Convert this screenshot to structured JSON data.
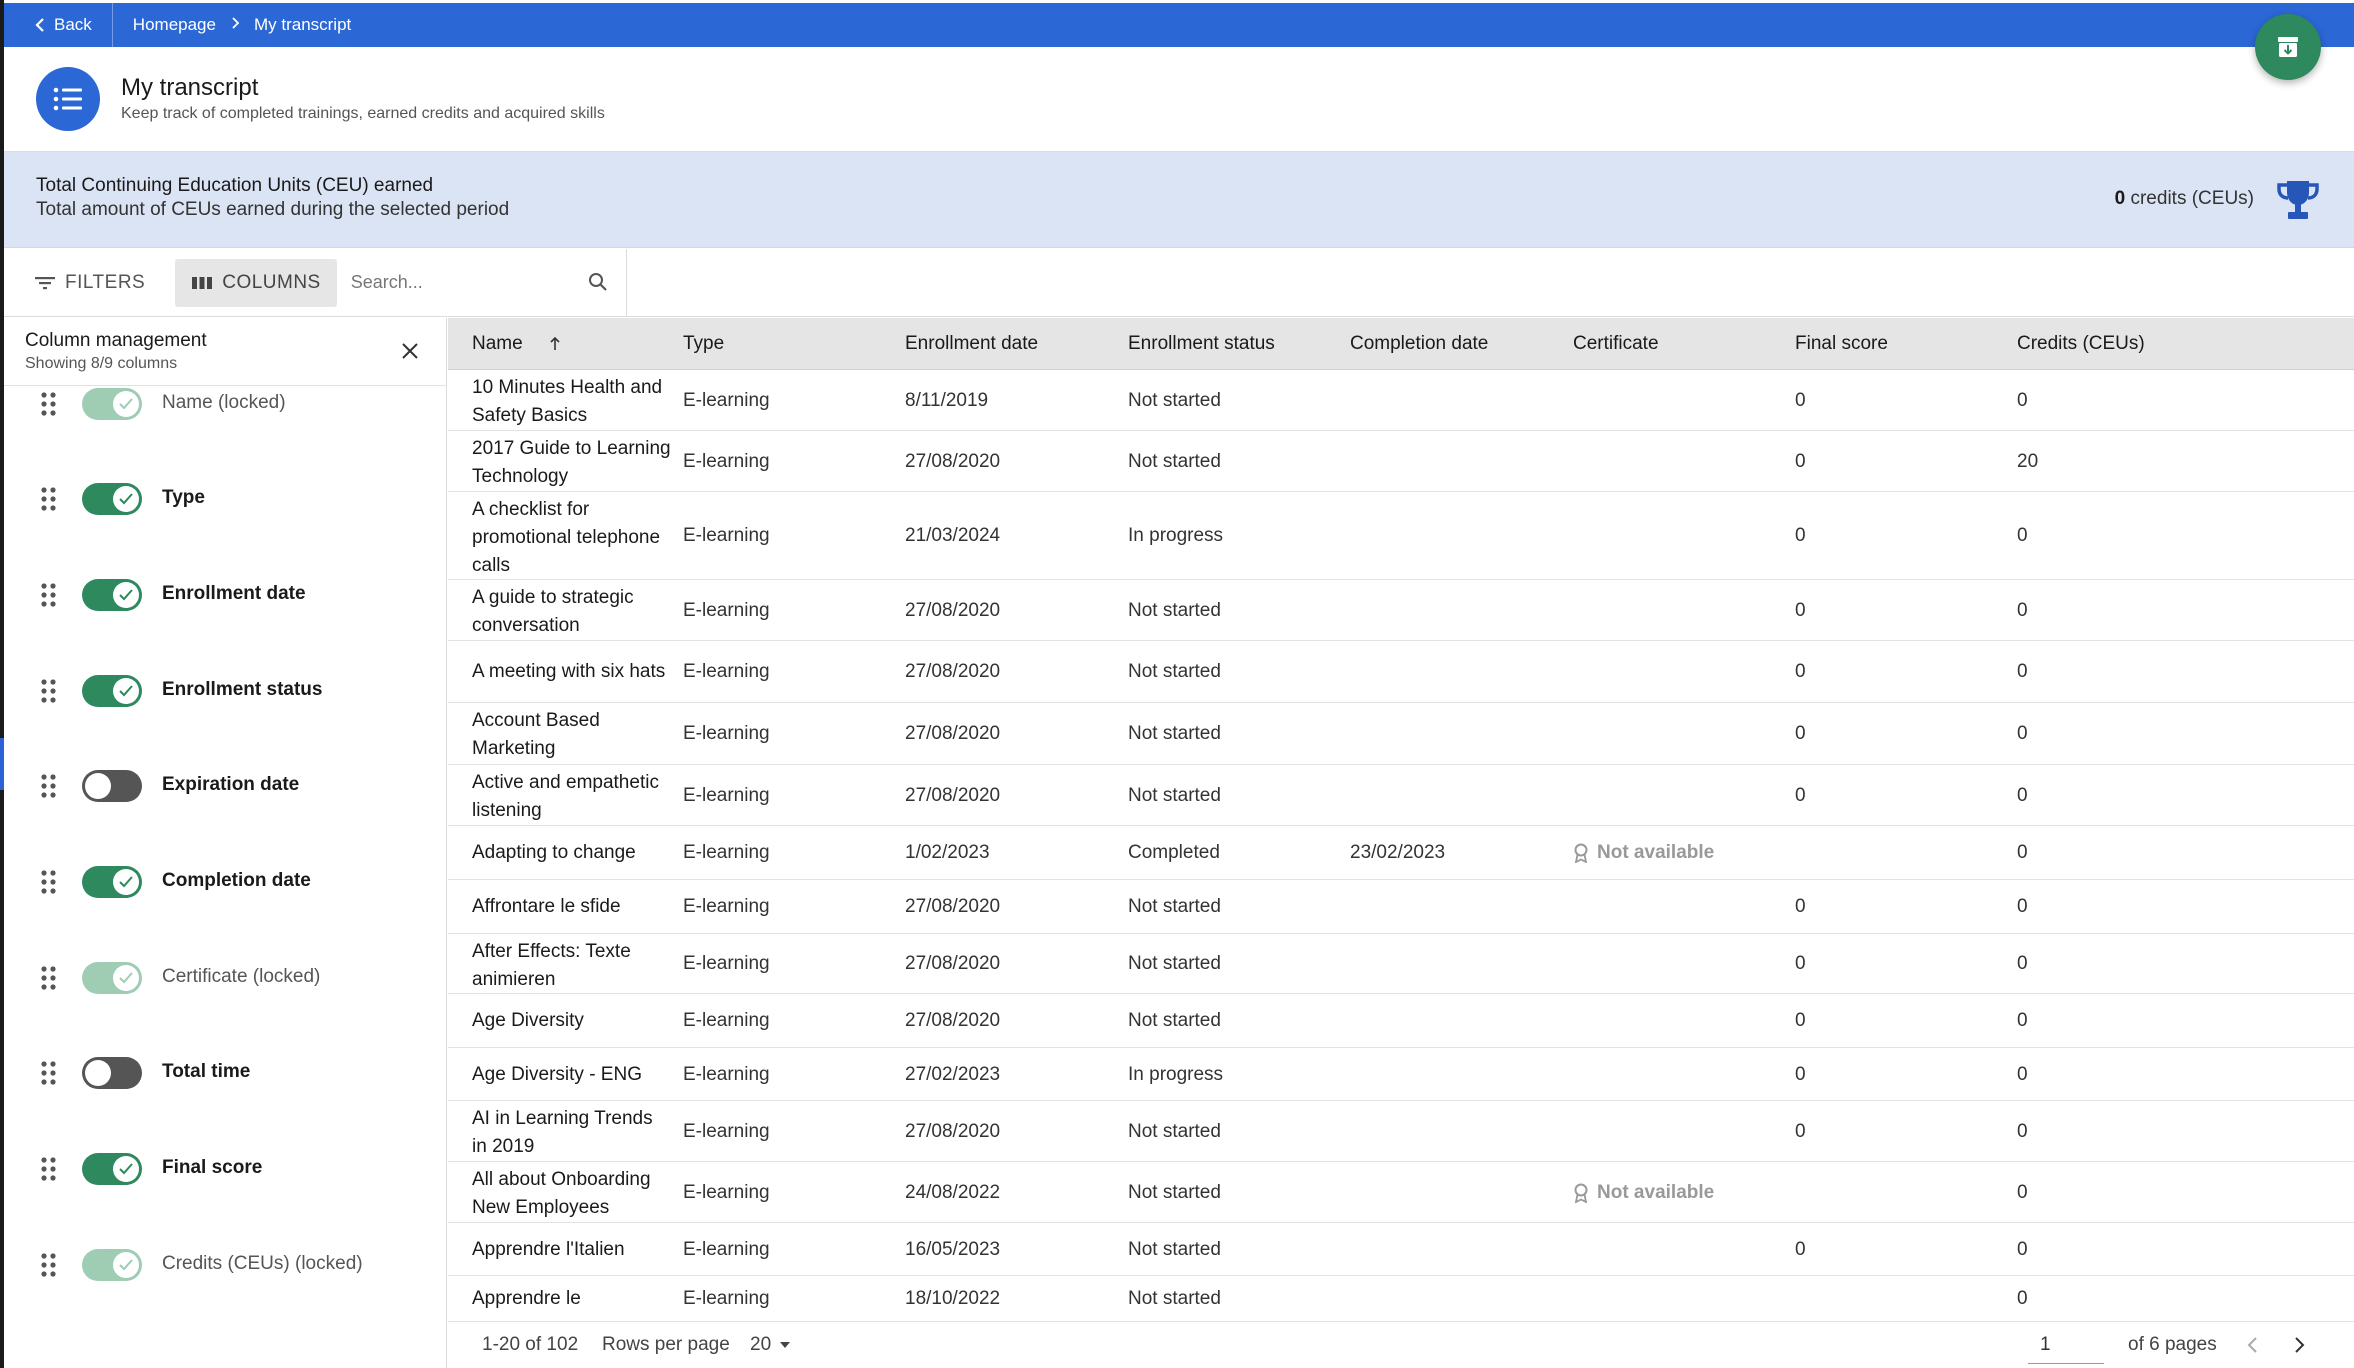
{
  "nav": {
    "back_label": "Back",
    "breadcrumb": [
      "Homepage",
      "My transcript"
    ]
  },
  "header": {
    "title": "My transcript",
    "subtitle": "Keep track of completed trainings, earned credits and acquired skills"
  },
  "ceu": {
    "title": "Total Continuing Education Units (CEU) earned",
    "subtitle": "Total amount of CEUs earned during the selected period",
    "value": "0",
    "unit": "credits (CEUs)"
  },
  "toolbar": {
    "filters_label": "FILTERS",
    "columns_label": "COLUMNS",
    "search_placeholder": "Search..."
  },
  "column_panel": {
    "title": "Column management",
    "subtitle": "Showing 8/9 columns",
    "items": [
      {
        "label": "Name",
        "locked_suffix": "(locked)",
        "state": "locked"
      },
      {
        "label": "Type",
        "locked_suffix": "",
        "state": "on"
      },
      {
        "label": "Enrollment date",
        "locked_suffix": "",
        "state": "on"
      },
      {
        "label": "Enrollment status",
        "locked_suffix": "",
        "state": "on"
      },
      {
        "label": "Expiration date",
        "locked_suffix": "",
        "state": "off"
      },
      {
        "label": "Completion date",
        "locked_suffix": "",
        "state": "on"
      },
      {
        "label": "Certificate",
        "locked_suffix": "(locked)",
        "state": "locked"
      },
      {
        "label": "Total time",
        "locked_suffix": "",
        "state": "off"
      },
      {
        "label": "Final score",
        "locked_suffix": "",
        "state": "on"
      },
      {
        "label": "Credits (CEUs)",
        "locked_suffix": "(locked)",
        "state": "locked"
      }
    ]
  },
  "table": {
    "columns": [
      "Name",
      "Type",
      "Enrollment date",
      "Enrollment status",
      "Completion date",
      "Certificate",
      "Final score",
      "Credits (CEUs)"
    ],
    "rows": [
      {
        "name": "10 Minutes Health and Safety Basics",
        "type": "E-learning",
        "enrollment_date": "8/11/2019",
        "status": "Not started",
        "completion_date": "",
        "certificate": "",
        "final_score": "0",
        "credits": "0"
      },
      {
        "name": "2017 Guide to Learning Technology",
        "type": "E-learning",
        "enrollment_date": "27/08/2020",
        "status": "Not started",
        "completion_date": "",
        "certificate": "",
        "final_score": "0",
        "credits": "20"
      },
      {
        "name": "A checklist for promotional telephone calls",
        "type": "E-learning",
        "enrollment_date": "21/03/2024",
        "status": "In progress",
        "completion_date": "",
        "certificate": "",
        "final_score": "0",
        "credits": "0"
      },
      {
        "name": "A guide to strategic conversation",
        "type": "E-learning",
        "enrollment_date": "27/08/2020",
        "status": "Not started",
        "completion_date": "",
        "certificate": "",
        "final_score": "0",
        "credits": "0"
      },
      {
        "name": "A meeting with six hats",
        "type": "E-learning",
        "enrollment_date": "27/08/2020",
        "status": "Not started",
        "completion_date": "",
        "certificate": "",
        "final_score": "0",
        "credits": "0"
      },
      {
        "name": "Account Based Marketing",
        "type": "E-learning",
        "enrollment_date": "27/08/2020",
        "status": "Not started",
        "completion_date": "",
        "certificate": "",
        "final_score": "0",
        "credits": "0"
      },
      {
        "name": "Active and empathetic listening",
        "type": "E-learning",
        "enrollment_date": "27/08/2020",
        "status": "Not started",
        "completion_date": "",
        "certificate": "",
        "final_score": "0",
        "credits": "0"
      },
      {
        "name": "Adapting to change",
        "type": "E-learning",
        "enrollment_date": "1/02/2023",
        "status": "Completed",
        "completion_date": "23/02/2023",
        "certificate": "Not available",
        "final_score": "",
        "credits": "0"
      },
      {
        "name": "Affrontare le sfide",
        "type": "E-learning",
        "enrollment_date": "27/08/2020",
        "status": "Not started",
        "completion_date": "",
        "certificate": "",
        "final_score": "0",
        "credits": "0"
      },
      {
        "name": "After Effects: Texte animieren",
        "type": "E-learning",
        "enrollment_date": "27/08/2020",
        "status": "Not started",
        "completion_date": "",
        "certificate": "",
        "final_score": "0",
        "credits": "0"
      },
      {
        "name": "Age Diversity",
        "type": "E-learning",
        "enrollment_date": "27/08/2020",
        "status": "Not started",
        "completion_date": "",
        "certificate": "",
        "final_score": "0",
        "credits": "0"
      },
      {
        "name": "Age Diversity - ENG",
        "type": "E-learning",
        "enrollment_date": "27/02/2023",
        "status": "In progress",
        "completion_date": "",
        "certificate": "",
        "final_score": "0",
        "credits": "0"
      },
      {
        "name": "AI in Learning Trends in 2019",
        "type": "E-learning",
        "enrollment_date": "27/08/2020",
        "status": "Not started",
        "completion_date": "",
        "certificate": "",
        "final_score": "0",
        "credits": "0"
      },
      {
        "name": "All about Onboarding New Employees",
        "type": "E-learning",
        "enrollment_date": "24/08/2022",
        "status": "Not started",
        "completion_date": "",
        "certificate": "Not available",
        "final_score": "",
        "credits": "0"
      },
      {
        "name": "Apprendre l'Italien",
        "type": "E-learning",
        "enrollment_date": "16/05/2023",
        "status": "Not started",
        "completion_date": "",
        "certificate": "",
        "final_score": "0",
        "credits": "0"
      },
      {
        "name": "Apprendre le",
        "type": "E-learning",
        "enrollment_date": "18/10/2022",
        "status": "Not started",
        "completion_date": "",
        "certificate": "",
        "final_score": "",
        "credits": "0"
      }
    ]
  },
  "pagination": {
    "range": "1-20 of 102",
    "rows_per_page_label": "Rows per page",
    "rows_per_page": "20",
    "current_page": "1",
    "of_pages": "of 6 pages"
  }
}
